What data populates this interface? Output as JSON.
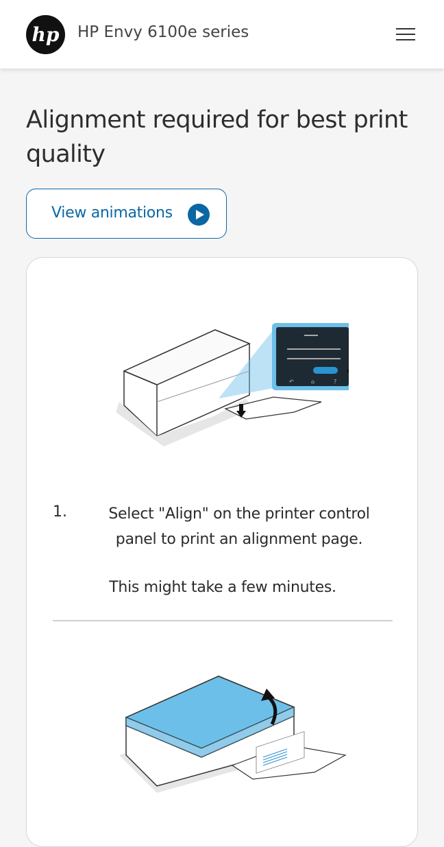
{
  "header": {
    "logo": "hp-logo",
    "product_name": "HP Envy 6100e series",
    "menu_icon": "hamburger-menu-icon"
  },
  "main": {
    "title": "Alignment required for best print quality",
    "view_animations_label": "View animations",
    "play_icon": "play-circle-icon"
  },
  "steps": [
    {
      "number": "1.",
      "text": "Select \"Align\" on the printer control panel to print an alignment page.",
      "note": "This might take a few minutes."
    }
  ],
  "colors": {
    "accent": "#0a67a4",
    "highlight_blue": "#6cbfe8",
    "background": "#f5f5f5"
  }
}
